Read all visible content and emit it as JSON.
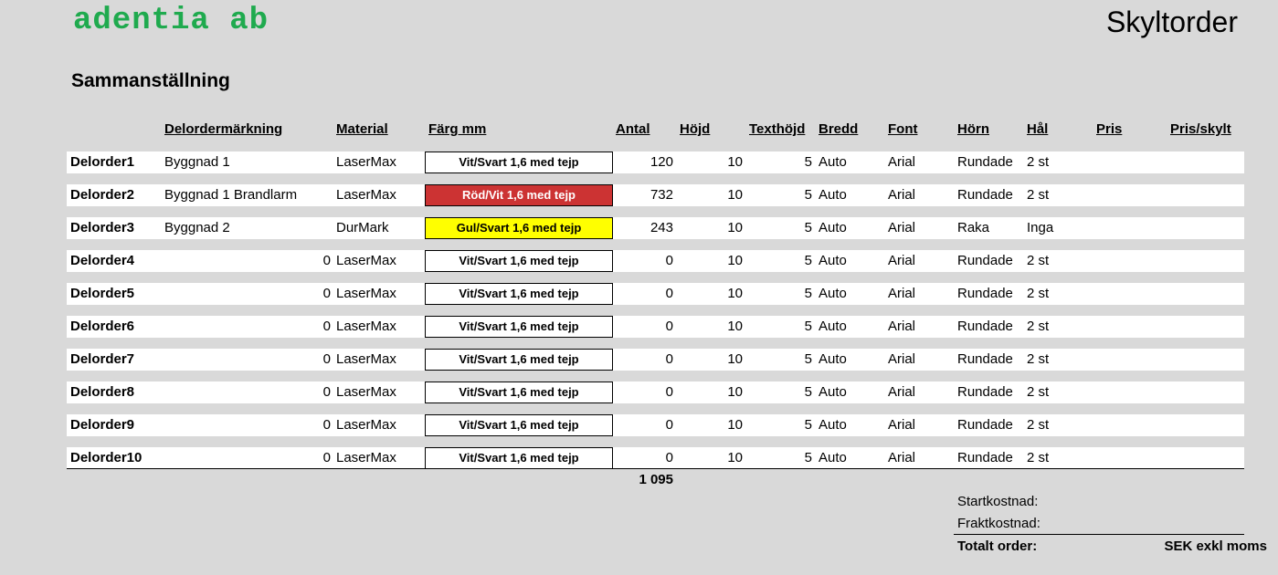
{
  "header": {
    "logo": "adentia ab",
    "title": "Skyltorder"
  },
  "section_title": "Sammanställning",
  "columns": {
    "delordermarkning": "Delordermärkning",
    "material": "Material",
    "farg": "Färg mm",
    "antal": "Antal",
    "hojd": "Höjd",
    "texthojd": "Texthöjd",
    "bredd": "Bredd",
    "font": "Font",
    "horn": "Hörn",
    "hal": "Hål",
    "pris": "Pris",
    "pris_skylt": "Pris/skylt"
  },
  "rows": [
    {
      "name": "Delorder1",
      "marking": "Byggnad 1",
      "material": "LaserMax",
      "color": "Vit/Svart 1,6 med tejp",
      "color_style": "white",
      "antal": "120",
      "hojd": "10",
      "texthojd": "5",
      "bredd": "Auto",
      "font": "Arial",
      "horn": "Rundade",
      "hal": "2 st"
    },
    {
      "name": "Delorder2",
      "marking": "Byggnad 1 Brandlarm",
      "material": "LaserMax",
      "color": "Röd/Vit 1,6 med tejp",
      "color_style": "red",
      "antal": "732",
      "hojd": "10",
      "texthojd": "5",
      "bredd": "Auto",
      "font": "Arial",
      "horn": "Rundade",
      "hal": "2 st"
    },
    {
      "name": "Delorder3",
      "marking": "Byggnad 2",
      "material": "DurMark",
      "color": "Gul/Svart 1,6 med tejp",
      "color_style": "yellow",
      "antal": "243",
      "hojd": "10",
      "texthojd": "5",
      "bredd": "Auto",
      "font": "Arial",
      "horn": "Raka",
      "hal": "Inga"
    },
    {
      "name": "Delorder4",
      "marking": "0",
      "material": "LaserMax",
      "color": "Vit/Svart 1,6 med tejp",
      "color_style": "white",
      "antal": "0",
      "hojd": "10",
      "texthojd": "5",
      "bredd": "Auto",
      "font": "Arial",
      "horn": "Rundade",
      "hal": "2 st"
    },
    {
      "name": "Delorder5",
      "marking": "0",
      "material": "LaserMax",
      "color": "Vit/Svart 1,6 med tejp",
      "color_style": "white",
      "antal": "0",
      "hojd": "10",
      "texthojd": "5",
      "bredd": "Auto",
      "font": "Arial",
      "horn": "Rundade",
      "hal": "2 st"
    },
    {
      "name": "Delorder6",
      "marking": "0",
      "material": "LaserMax",
      "color": "Vit/Svart 1,6 med tejp",
      "color_style": "white",
      "antal": "0",
      "hojd": "10",
      "texthojd": "5",
      "bredd": "Auto",
      "font": "Arial",
      "horn": "Rundade",
      "hal": "2 st"
    },
    {
      "name": "Delorder7",
      "marking": "0",
      "material": "LaserMax",
      "color": "Vit/Svart 1,6 med tejp",
      "color_style": "white",
      "antal": "0",
      "hojd": "10",
      "texthojd": "5",
      "bredd": "Auto",
      "font": "Arial",
      "horn": "Rundade",
      "hal": "2 st"
    },
    {
      "name": "Delorder8",
      "marking": "0",
      "material": "LaserMax",
      "color": "Vit/Svart 1,6 med tejp",
      "color_style": "white",
      "antal": "0",
      "hojd": "10",
      "texthojd": "5",
      "bredd": "Auto",
      "font": "Arial",
      "horn": "Rundade",
      "hal": "2 st"
    },
    {
      "name": "Delorder9",
      "marking": "0",
      "material": "LaserMax",
      "color": "Vit/Svart 1,6 med tejp",
      "color_style": "white",
      "antal": "0",
      "hojd": "10",
      "texthojd": "5",
      "bredd": "Auto",
      "font": "Arial",
      "horn": "Rundade",
      "hal": "2 st"
    },
    {
      "name": "Delorder10",
      "marking": "0",
      "material": "LaserMax",
      "color": "Vit/Svart 1,6 med tejp",
      "color_style": "white",
      "antal": "0",
      "hojd": "10",
      "texthojd": "5",
      "bredd": "Auto",
      "font": "Arial",
      "horn": "Rundade",
      "hal": "2 st"
    }
  ],
  "total_antal": "1 095",
  "summary": {
    "startkostnad": "Startkostnad:",
    "fraktkostnad": "Fraktkostnad:",
    "totalt_order": "Totalt order:",
    "unit": "SEK exkl moms"
  },
  "colors": {
    "logo": "#1faa4e",
    "red_box": "#cc3333",
    "yellow_box": "#ffff00",
    "background": "#d9d9d9"
  }
}
